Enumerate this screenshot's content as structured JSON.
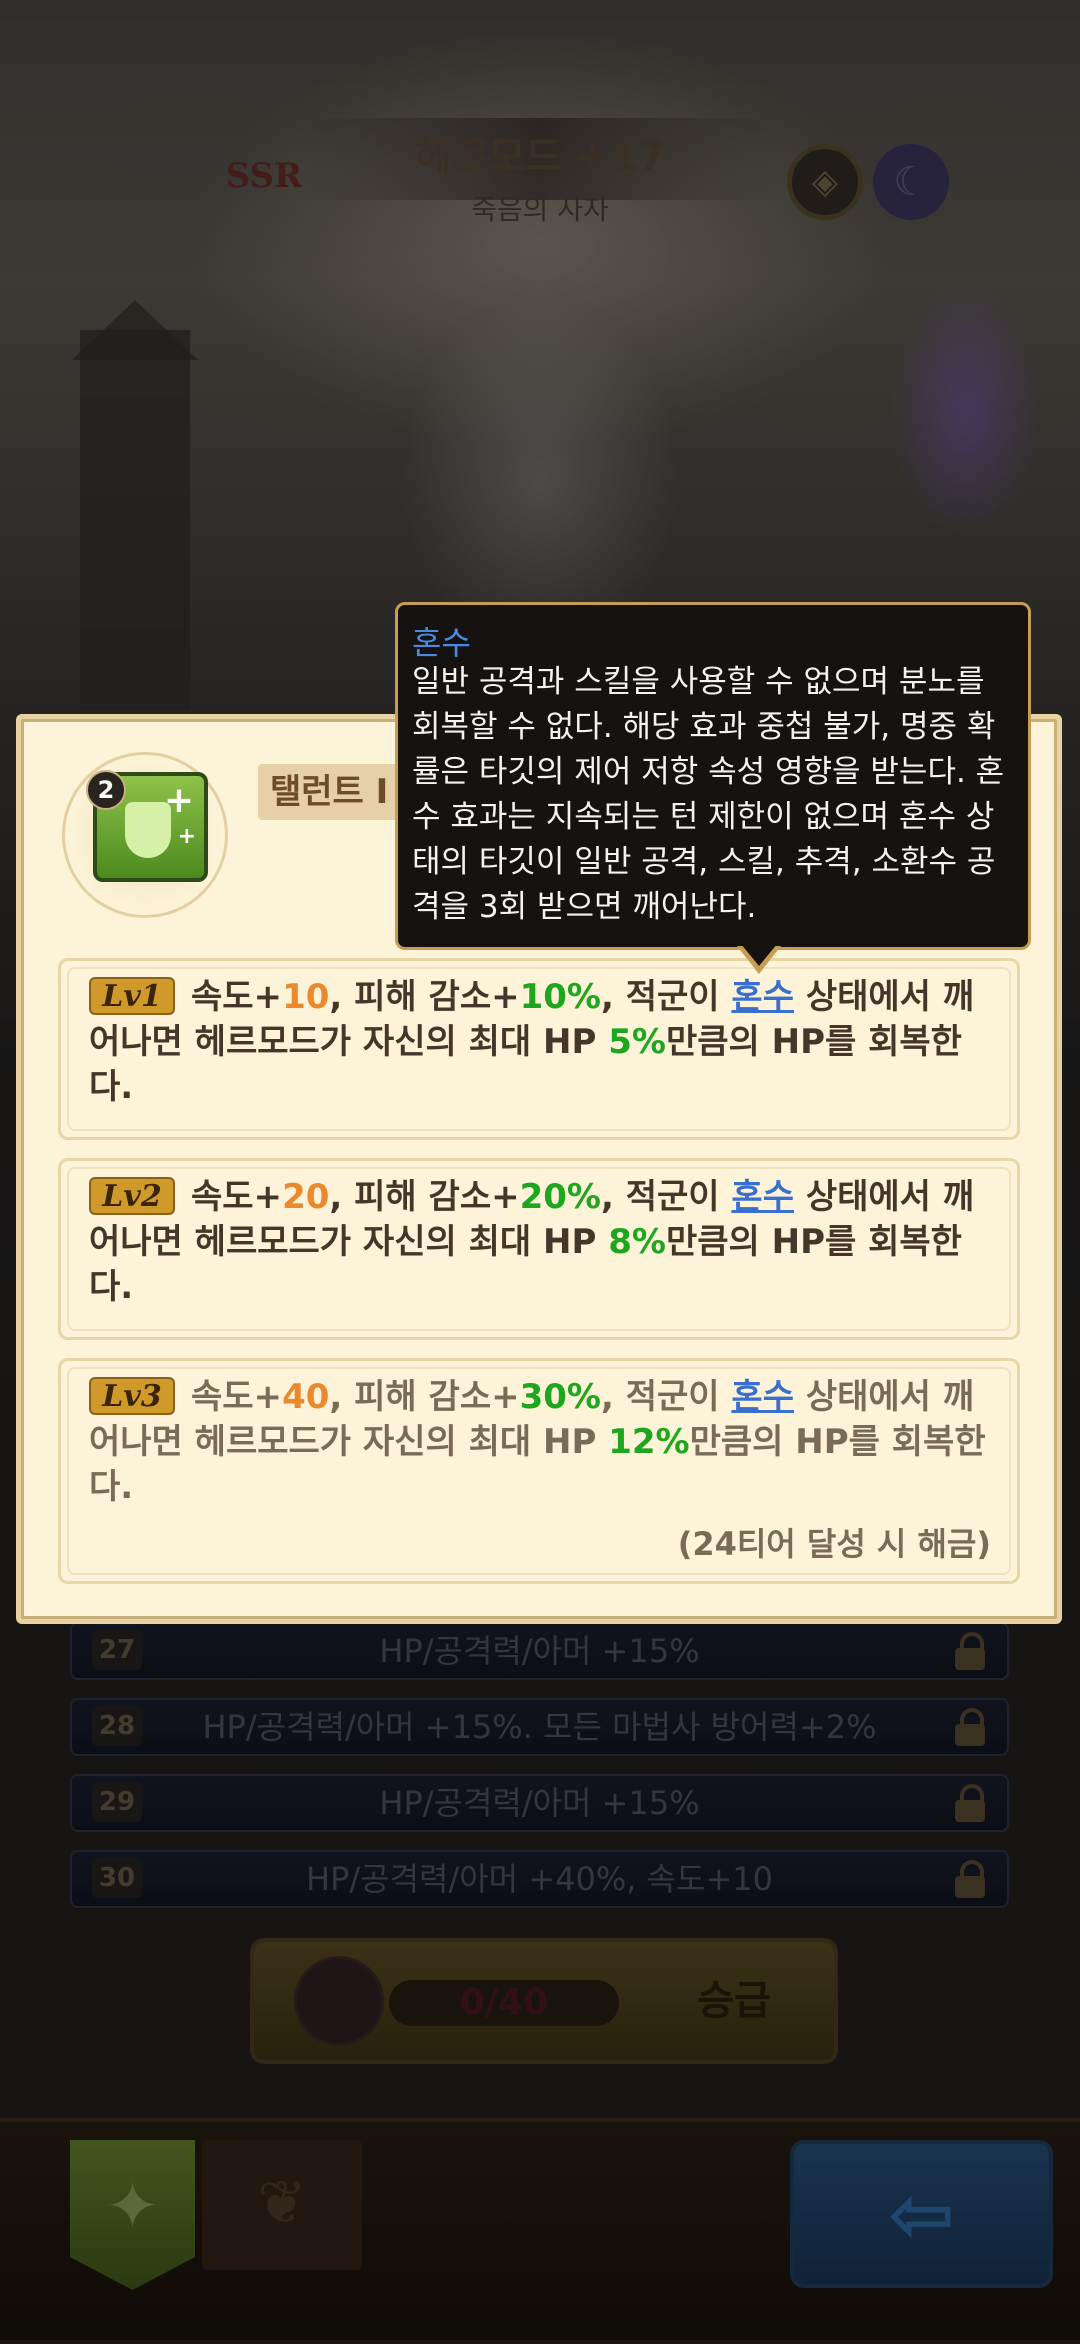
{
  "hero": {
    "rarity": "SSR",
    "name": "헤르모드 +17",
    "title": "죽음의 사자"
  },
  "talent": {
    "rank": "2",
    "name": "탤런트 I",
    "levels": [
      {
        "badge": "Lv1",
        "parts": [
          "속도+",
          "10",
          ", 피해 감소+",
          "10%",
          ", 적군이 ",
          "혼수",
          " 상태에서 깨어나면 헤르모드가 자신의 최대 HP ",
          "5%",
          "만큼의 HP를 회복한다."
        ]
      },
      {
        "badge": "Lv2",
        "parts": [
          "속도+",
          "20",
          ", 피해 감소+",
          "20%",
          ", 적군이 ",
          "혼수",
          " 상태에서 깨어나면 헤르모드가 자신의 최대 HP ",
          "8%",
          "만큼의 HP를 회복한다."
        ]
      },
      {
        "badge": "Lv3",
        "parts": [
          "속도+",
          "40",
          ", 피해 감소+",
          "30%",
          ", 적군이 ",
          "혼수",
          " 상태에서 깨어나면 헤르모드가 자신의 최대 HP ",
          "12%",
          "만큼의 HP를 회복한다."
        ],
        "unlock_note": "(24티어 달성 시 해금)"
      }
    ]
  },
  "tooltip": {
    "title": "혼수",
    "body": "일반 공격과 스킬을 사용할 수 없으며 분노를 회복할 수 없다. 해당 효과 중첩 불가, 명중 확률은 타깃의 제어 저항 속성 영향을 받는다. 혼수 효과는 지속되는 턴 제한이 없으며 혼수 상태의 타깃이 일반 공격, 스킬, 추격, 소환수 공격을 3회 받으면 깨어난다."
  },
  "talent_rows": [
    {
      "num": "27",
      "label": "HP/공격력/아머 +15%"
    },
    {
      "num": "28",
      "label": "HP/공격력/아머 +15%. 모든 마법사 방어력+2%"
    },
    {
      "num": "29",
      "label": "HP/공격력/아머 +15%"
    },
    {
      "num": "30",
      "label": "HP/공격력/아머 +40%, 속도+10"
    }
  ],
  "promote": {
    "progress": "0/40",
    "label": "승급"
  },
  "bottom_nav": {
    "talent_tab_icon": "compass-star-icon",
    "second_tab_icon": "emblem-icon",
    "back_icon": "arrow-left-icon"
  },
  "colors": {
    "stat_orange": "#e98a2e",
    "stat_green": "#1ea61e",
    "keyword_blue": "#3b6fce",
    "tooltip_border": "#c69d52"
  }
}
